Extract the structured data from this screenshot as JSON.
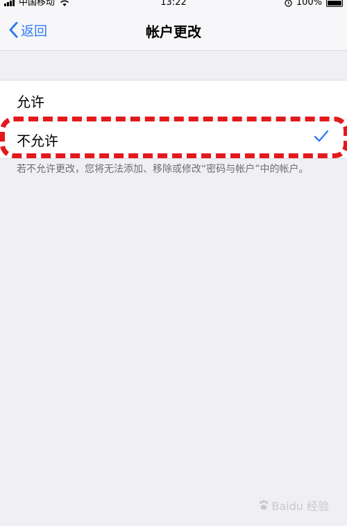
{
  "status": {
    "carrier": "中国移动",
    "time": "13:22",
    "battery": "100%"
  },
  "nav": {
    "back_label": "返回",
    "title": "帐户更改"
  },
  "options": {
    "allow_label": "允许",
    "deny_label": "不允许",
    "selected": "不允许"
  },
  "footer": {
    "text": "若不允许更改，您将无法添加、移除或修改“密码与帐户”中的帐户。"
  },
  "watermark": {
    "text": "Baidu 经验"
  },
  "colors": {
    "accent": "#2f7bf6",
    "highlight": "#e3191c",
    "background": "#efeff4"
  }
}
